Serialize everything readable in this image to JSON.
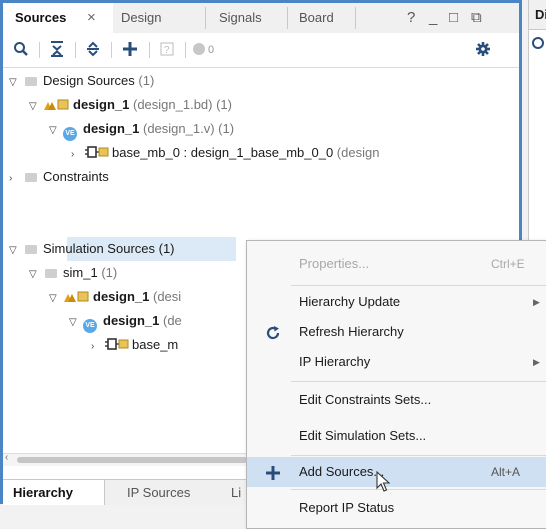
{
  "tabs": [
    {
      "label": "Sources",
      "active": true
    },
    {
      "label": "Design",
      "active": false
    },
    {
      "label": "Signals",
      "active": false
    },
    {
      "label": "Board",
      "active": false
    }
  ],
  "tab_close_glyph": "×",
  "window_controls": {
    "help": "?",
    "minimize": "_",
    "maximize": "□",
    "float": "⧉"
  },
  "toolbar": {
    "search_icon": "search-icon",
    "collapse_icon": "collapse-all-icon",
    "expand_icon": "expand-all-icon",
    "add_icon": "add-icon",
    "properties_icon": "question-icon",
    "status_count": "0",
    "settings_icon": "gear-icon"
  },
  "tree": {
    "design_sources": {
      "label": "Design Sources",
      "count": "(1)"
    },
    "design_bd": {
      "label": "design_1",
      "detail": "(design_1.bd) (1)"
    },
    "design_v": {
      "label": "design_1",
      "detail": "(design_1.v) (1)"
    },
    "base_mb": {
      "label": "base_mb_0 : design_1_base_mb_0_0",
      "detail": "(design"
    },
    "constraints": {
      "label": "Constraints"
    },
    "simulation_sources": {
      "label": "Simulation Sources (1)"
    },
    "sim_1": {
      "label": "sim_1",
      "count": "(1)"
    },
    "sim_design_bd": {
      "label": "design_1",
      "detail": "(desi"
    },
    "sim_design_v": {
      "label": "design_1",
      "detail": "(de"
    },
    "sim_base_mb": {
      "label": "base_m"
    }
  },
  "bottom_tabs": [
    {
      "label": "Hierarchy",
      "active": true
    },
    {
      "label": "IP Sources",
      "active": false
    },
    {
      "label": "Li",
      "active": false
    }
  ],
  "right_panel": {
    "title": "Di"
  },
  "context_menu": {
    "properties": {
      "label": "Properties...",
      "shortcut": "Ctrl+E"
    },
    "hierarchy_update": {
      "label": "Hierarchy Update"
    },
    "refresh_hierarchy": {
      "label": "Refresh Hierarchy"
    },
    "ip_hierarchy": {
      "label": "IP Hierarchy"
    },
    "edit_constraints": {
      "label": "Edit Constraints Sets..."
    },
    "edit_simulation": {
      "label": "Edit Simulation Sets..."
    },
    "add_sources": {
      "label": "Add Sources...",
      "shortcut": "Alt+A"
    },
    "report_ip_status": {
      "label": "Report IP Status"
    }
  },
  "colors": {
    "accent": "#4a86c6",
    "selection": "#dce9f7",
    "menu_highlight": "#cfe0f3"
  }
}
